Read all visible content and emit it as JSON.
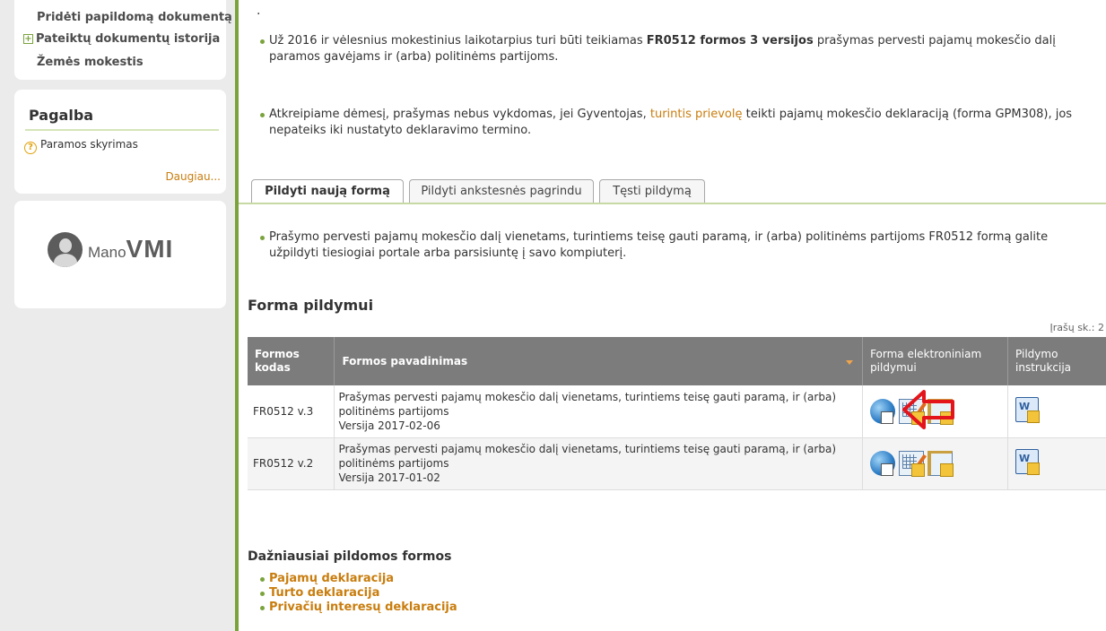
{
  "sidebar": {
    "menu": {
      "item_add_document": "Pridėti papildomą dokumentą",
      "item_history": "Pateiktų dokumentų istorija",
      "item_land_tax": "Žemės mokestis",
      "expand_symbol": "+"
    },
    "help": {
      "title": "Pagalba",
      "link_support": "Paramos skyrimas",
      "more": "Daugiau...",
      "question_symbol": "?"
    },
    "logo": {
      "mano": "Mano",
      "vmi": "VMI"
    }
  },
  "main": {
    "top_dot": ".",
    "notice1": {
      "before": "Už 2016 ir vėlesnius mokestinius laikotarpius turi būti teikiamas ",
      "bold": "FR0512 formos 3 versijos",
      "after": " prašymas pervesti pajamų mokesčio dalį paramos gavėjams ir (arba) politinėms partijoms."
    },
    "notice2": {
      "before": "Atkreipiame dėmesį, prašymas nebus vykdomas, jei Gyventojas, ",
      "link": "turintis prievolę",
      "after": " teikti pajamų mokesčio deklaraciją (forma GPM308), jos nepateiks iki nustatyto deklaravimo termino."
    },
    "tabs": [
      {
        "label": "Pildyti naują formą",
        "active": true
      },
      {
        "label": "Pildyti ankstesnės pagrindu",
        "active": false
      },
      {
        "label": "Tęsti pildymą",
        "active": false
      }
    ],
    "notice3": "Prašymo pervesti pajamų mokesčio dalį vienetams, turintiems teisę gauti paramą, ir (arba) politinėms partijoms FR0512 formą galite užpildyti tiesiogiai portale arba parsisiuntę į savo kompiuterį.",
    "section_title": "Forma pildymui",
    "record_count": "Įrašų sk.: 2",
    "table": {
      "headers": {
        "code": "Formos kodas",
        "name": "Formos pavadinimas",
        "electronic": "Forma elektroniniam pildymui",
        "instructions": "Pildymo instrukcija"
      },
      "rows": [
        {
          "code": "FR0512 v.3",
          "name": "Prašymas pervesti pajamų mokesčio dalį vienetams, turintiems teisę gauti paramą, ir (arba) politinėms partijoms",
          "version": "Versija 2017-02-06"
        },
        {
          "code": "FR0512 v.2",
          "name": "Prašymas pervesti pajamų mokesčio dalį vienetams, turintiems teisę gauti paramą, ir (arba) politinėms partijoms",
          "version": "Versija 2017-01-02"
        }
      ]
    },
    "frequent": {
      "title": "Dažniausiai pildomos formos",
      "links": [
        "Pajamų deklaracija",
        "Turto deklaracija",
        "Privačių interesų deklaracija"
      ]
    },
    "accent_color": "#7aa33c",
    "link_color": "#c97d0e",
    "annotation_arrow_color": "#e4141b"
  }
}
